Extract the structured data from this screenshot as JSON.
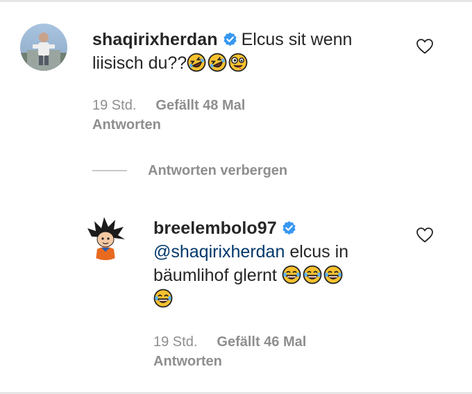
{
  "comments": [
    {
      "username": "shaqirixherdan",
      "verified": true,
      "text_line1": "Elcus sit wenn",
      "text_line2": "liisisch du??",
      "emojis": [
        "rolling-on-floor-laughing",
        "rolling-on-floor-laughing",
        "zany-face"
      ],
      "time": "19 Std.",
      "likes": "Gefällt 48 Mal",
      "reply_label": "Antworten"
    }
  ],
  "hide_replies_label": "Antworten verbergen",
  "replies": [
    {
      "username": "breelembolo97",
      "verified": true,
      "mention": "@shaqirixherdan",
      "text_after_mention": " elcus in",
      "text_line2": "bäumlihof glernt ",
      "emojis_line2": [
        "face-with-tears-of-joy",
        "face-with-tears-of-joy",
        "face-with-tears-of-joy"
      ],
      "emojis_line3": [
        "face-with-tears-of-joy"
      ],
      "time": "19 Std.",
      "likes": "Gefällt 46 Mal",
      "reply_label": "Antworten"
    }
  ],
  "colors": {
    "verified_badge": "#3897f0",
    "meta_text": "#8e8e8e",
    "mention": "#00376b"
  }
}
